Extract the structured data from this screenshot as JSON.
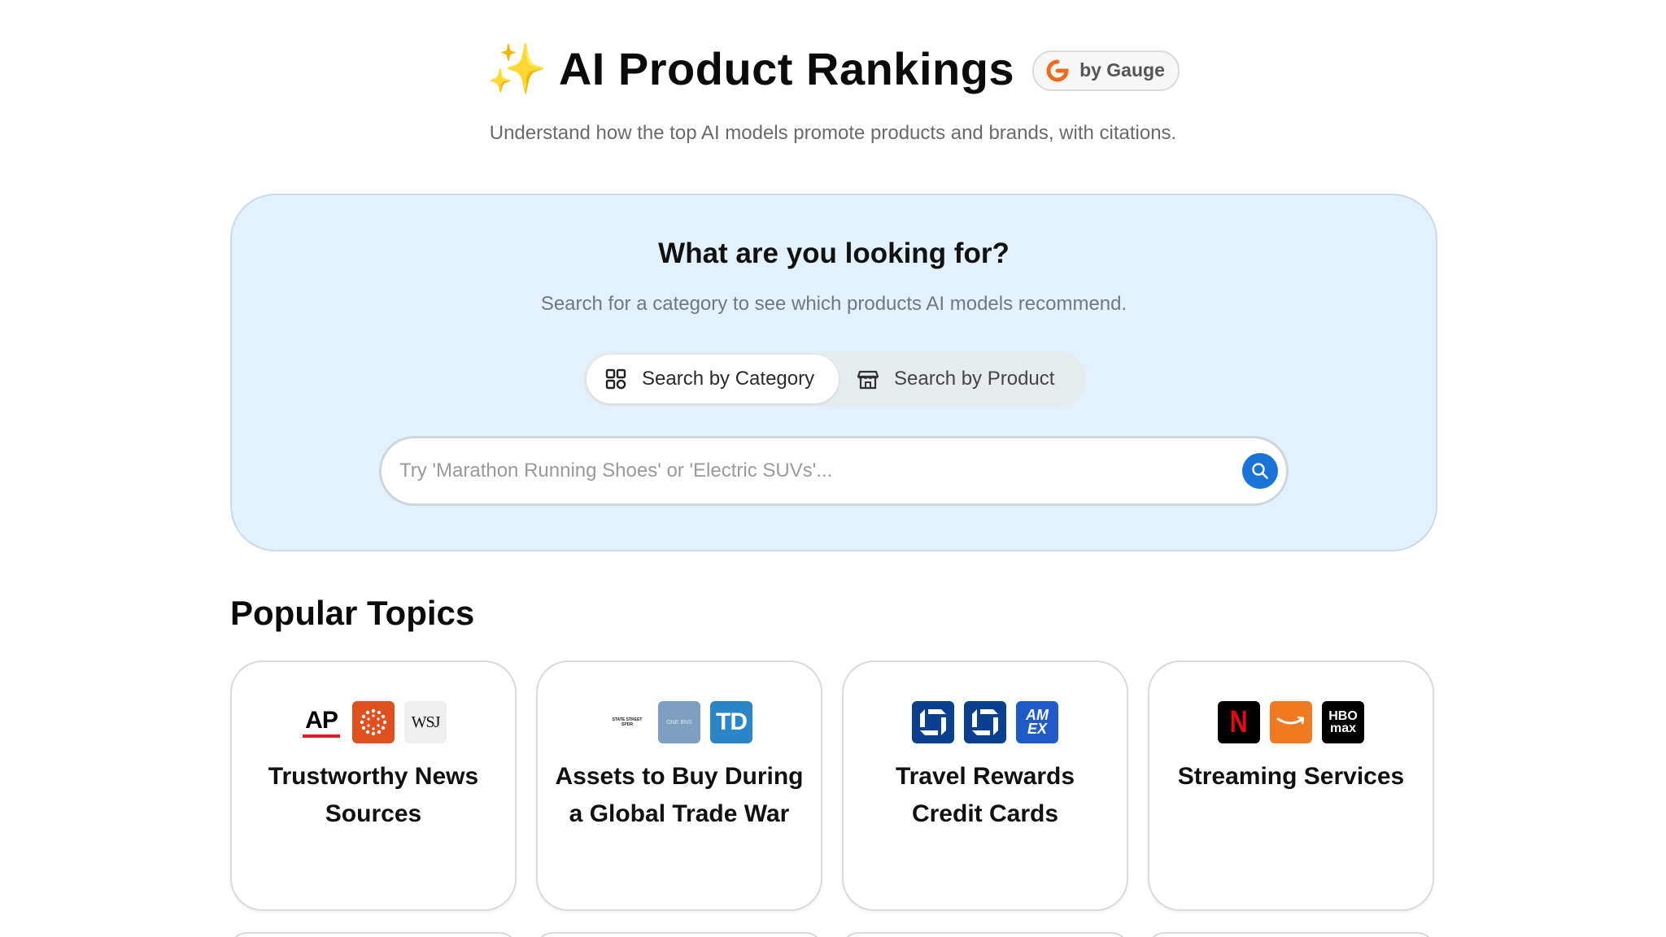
{
  "header": {
    "sparkle_glyph": "✨",
    "title": "AI Product Rankings",
    "badge_label": "by Gauge",
    "badge_color": "#f26a1b",
    "subtitle": "Understand how the top AI models promote products and brands, with citations."
  },
  "search_panel": {
    "heading": "What are you looking for?",
    "subheading": "Search for a category to see which products AI models recommend.",
    "tabs": [
      {
        "label": "Search by Category",
        "icon": "grid-icon",
        "active": true
      },
      {
        "label": "Search by Product",
        "icon": "store-icon",
        "active": false
      }
    ],
    "search": {
      "placeholder": "Try 'Marathon Running Shoes' or 'Electric SUVs'...",
      "value": "",
      "button_icon": "search-icon",
      "button_color": "#1a73d9"
    },
    "background_color": "#e2f1fb"
  },
  "popular": {
    "title": "Popular Topics",
    "cards": [
      {
        "label": "Trustworthy News Sources",
        "logos": [
          {
            "name": "ap-logo",
            "text": "AP"
          },
          {
            "name": "reuters-logo",
            "text": ""
          },
          {
            "name": "wsj-logo",
            "text": "WSJ"
          }
        ]
      },
      {
        "label": "Assets to Buy During a Global Trade War",
        "logos": [
          {
            "name": "state-street-spdr-logo",
            "text": "STATE STREET SPDR"
          },
          {
            "name": "one-brand-logo",
            "text": "ONE BNS"
          },
          {
            "name": "td-logo",
            "text": "TD"
          }
        ]
      },
      {
        "label": "Travel Rewards Credit Cards",
        "logos": [
          {
            "name": "chase-logo-1",
            "text": ""
          },
          {
            "name": "chase-logo-2",
            "text": ""
          },
          {
            "name": "amex-logo",
            "text": "AM EX"
          }
        ]
      },
      {
        "label": "Streaming Services",
        "logos": [
          {
            "name": "netflix-logo",
            "text": "N"
          },
          {
            "name": "amazon-logo",
            "text": ""
          },
          {
            "name": "hbo-max-logo",
            "text": "HBO max"
          }
        ]
      }
    ]
  }
}
